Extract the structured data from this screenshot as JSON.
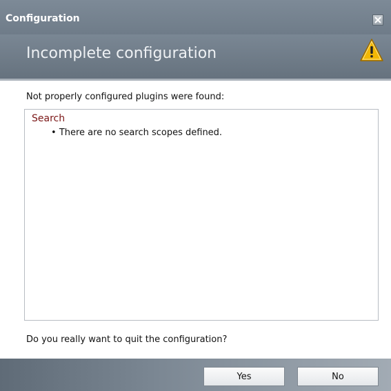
{
  "window": {
    "title": "Configuration",
    "banner_title": "Incomplete configuration"
  },
  "content": {
    "intro": "Not properly configured plugins were found:",
    "plugins": [
      {
        "name": "Search",
        "issue": "There are no search scopes defined."
      }
    ],
    "question": "Do you really want to quit the configuration?"
  },
  "buttons": {
    "yes_label": "Yes",
    "no_label": "No"
  },
  "icons": {
    "close": "close-icon",
    "warning": "warning-triangle-icon"
  },
  "colors": {
    "titlebar": "#6b7885",
    "plugin_name": "#7a1515",
    "warning_fill": "#f2b705"
  }
}
